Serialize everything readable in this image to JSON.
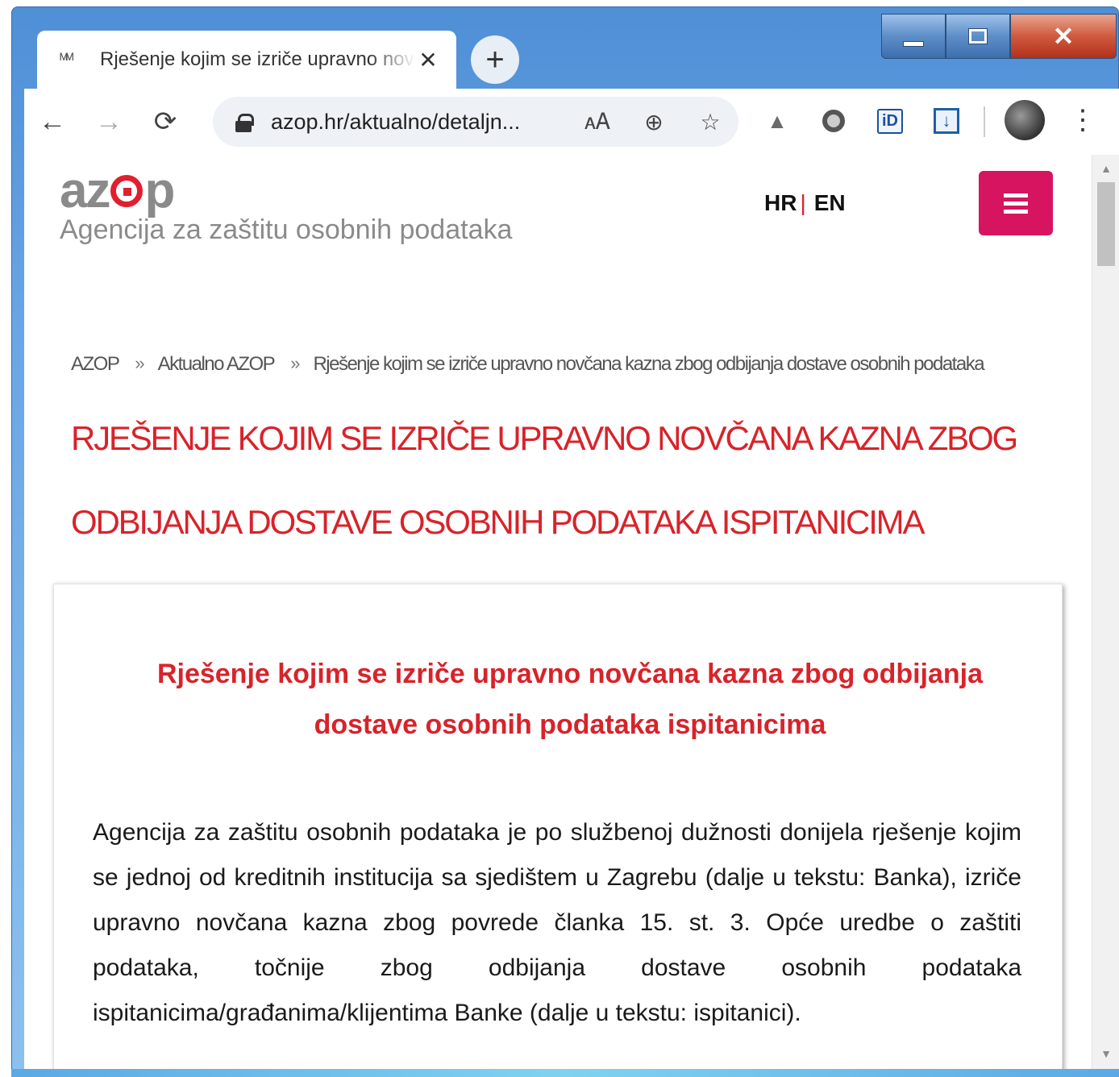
{
  "browser": {
    "tab_title": "Rješenje kojim se izriče upravno novčana kazna zbog odbijanja dostave osobnih podataka ispitanicima",
    "tab_close": "✕",
    "new_tab": "+",
    "url": "azop.hr/aktualno/detaljn...",
    "nav": {
      "back": "←",
      "forward": "→",
      "reload": "⟳"
    },
    "omnibox_icons": [
      "translate-icon",
      "zoom-icon",
      "star-icon"
    ],
    "extensions": [
      "google-drive-icon",
      "circle-extension-icon",
      "id-extension-icon",
      "download-extension-icon"
    ],
    "id_ext_label": "iD",
    "menu": "⋮"
  },
  "window": {
    "minimize": "minimize",
    "maximize": "maximize",
    "close": "✕"
  },
  "site": {
    "logo_text_left": "az",
    "logo_text_right": "p",
    "logo_subtitle": "Agencija za zaštitu osobnih podataka",
    "lang_hr": "HR",
    "lang_sep": "|",
    "lang_en": "EN"
  },
  "breadcrumb": {
    "items": [
      "AZOP",
      "Aktualno AZOP",
      "Rješenje kojim se izriče upravno novčana kazna zbog odbijanja dostave osobnih podataka"
    ],
    "separator": "»"
  },
  "page_title": "RJEŠENJE KOJIM SE IZRIČE UPRAVNO NOVČANA KAZNA ZBOG ODBIJANJA DOSTAVE OSOBNIH PODATAKA ISPITANICIMA",
  "article": {
    "heading": "Rješenje kojim se izriče upravno novčana kazna zbog odbijanja dostave osobnih podataka ispitanicima",
    "paragraph": "Agencija za zaštitu osobnih podataka je po službenoj dužnosti donijela rješenje kojim se jednoj od kreditnih institucija sa sjedištem u Zagrebu (dalje u tekstu: Banka), izriče upravno novčana kazna zbog povrede članka 15. st. 3. Opće uredbe o zaštiti podataka, točnije zbog odbijanja dostave osobnih podataka ispitanicima/građanima/klijentima Banke (dalje u tekstu: ispitanici)."
  },
  "colors": {
    "accent_red": "#d8232a",
    "menu_magenta": "#d6145f",
    "logo_grey": "#8a8a8a"
  }
}
